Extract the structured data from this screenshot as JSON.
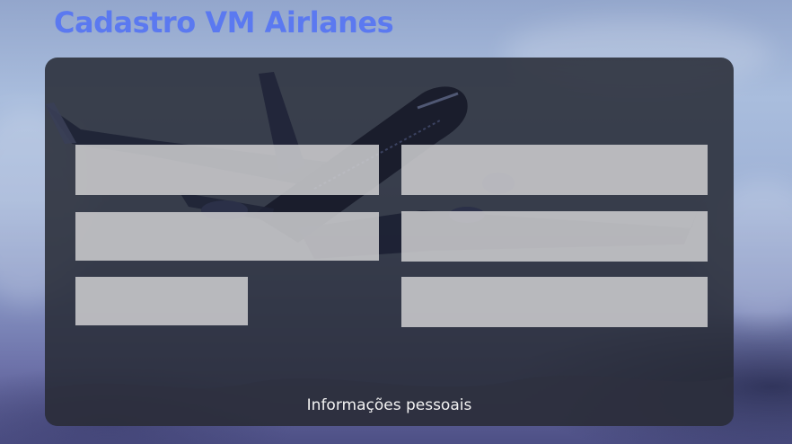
{
  "page": {
    "title": "Cadastro VM Airlanes"
  },
  "form": {
    "section_label": "Informações pessoais",
    "fields": [
      {
        "value": "",
        "placeholder": ""
      },
      {
        "value": "",
        "placeholder": ""
      },
      {
        "value": "",
        "placeholder": ""
      },
      {
        "value": "",
        "placeholder": ""
      },
      {
        "value": "",
        "placeholder": ""
      },
      {
        "value": "",
        "placeholder": ""
      }
    ]
  },
  "colors": {
    "title": "#5b79f0",
    "card_background": "#262a34",
    "field_background": "#cecece",
    "label_text": "#f2f2f2"
  },
  "icons": {
    "background_art": "airplane-illustration"
  }
}
